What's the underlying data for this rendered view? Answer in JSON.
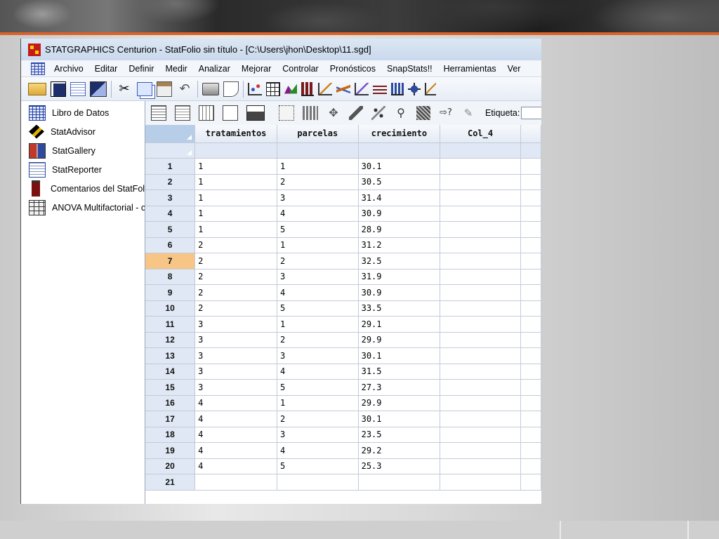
{
  "window": {
    "title": "STATGRAPHICS Centurion - StatFolio sin título - [C:\\Users\\jhon\\Desktop\\11.sgd]"
  },
  "menu": [
    "Archivo",
    "Editar",
    "Definir",
    "Medir",
    "Analizar",
    "Mejorar",
    "Controlar",
    "Pronósticos",
    "SnapStats!!",
    "Herramientas",
    "Ver"
  ],
  "toolbar_icons": [
    "open-folder-icon",
    "save-icon",
    "datasheet-icon",
    "save-all-icon",
    "cut-icon",
    "copy-icon",
    "paste-icon",
    "undo-icon",
    "print-icon",
    "print-preview-icon",
    "scatterplot-icon",
    "table-icon",
    "chart-icon",
    "bar-icon",
    "line-chart-icon",
    "regression-icon",
    "scatter-matrix-icon",
    "list-icon",
    "histogram-icon",
    "crosshair-icon",
    "plot-icon"
  ],
  "sidebar": {
    "items": [
      {
        "label": "Libro de Datos",
        "icon": "datasheet-icon"
      },
      {
        "label": "StatAdvisor",
        "icon": "statadvisor-icon"
      },
      {
        "label": "StatGallery",
        "icon": "statgallery-icon"
      },
      {
        "label": "StatReporter",
        "icon": "statreporter-icon"
      },
      {
        "label": "Comentarios del StatFolio",
        "icon": "comments-icon"
      },
      {
        "label": "ANOVA Multifactorial - cr",
        "icon": "anova-icon"
      }
    ]
  },
  "sheet_toolbar": {
    "label": "Etiqueta:",
    "value": ""
  },
  "table": {
    "columns": [
      "tratamientos",
      "parcelas",
      "crecimiento",
      "Col_4"
    ],
    "selected_row": 7,
    "rows": [
      {
        "n": "1",
        "cells": [
          "1",
          "1",
          "30.1",
          ""
        ]
      },
      {
        "n": "2",
        "cells": [
          "1",
          "2",
          "30.5",
          ""
        ]
      },
      {
        "n": "3",
        "cells": [
          "1",
          "3",
          "31.4",
          ""
        ]
      },
      {
        "n": "4",
        "cells": [
          "1",
          "4",
          "30.9",
          ""
        ]
      },
      {
        "n": "5",
        "cells": [
          "1",
          "5",
          "28.9",
          ""
        ]
      },
      {
        "n": "6",
        "cells": [
          "2",
          "1",
          "31.2",
          ""
        ]
      },
      {
        "n": "7",
        "cells": [
          "2",
          "2",
          "32.5",
          ""
        ]
      },
      {
        "n": "8",
        "cells": [
          "2",
          "3",
          "31.9",
          ""
        ]
      },
      {
        "n": "9",
        "cells": [
          "2",
          "4",
          "30.9",
          ""
        ]
      },
      {
        "n": "10",
        "cells": [
          "2",
          "5",
          "33.5",
          ""
        ]
      },
      {
        "n": "11",
        "cells": [
          "3",
          "1",
          "29.1",
          ""
        ]
      },
      {
        "n": "12",
        "cells": [
          "3",
          "2",
          "29.9",
          ""
        ]
      },
      {
        "n": "13",
        "cells": [
          "3",
          "3",
          "30.1",
          ""
        ]
      },
      {
        "n": "14",
        "cells": [
          "3",
          "4",
          "31.5",
          ""
        ]
      },
      {
        "n": "15",
        "cells": [
          "3",
          "5",
          "27.3",
          ""
        ]
      },
      {
        "n": "16",
        "cells": [
          "4",
          "1",
          "29.9",
          ""
        ]
      },
      {
        "n": "17",
        "cells": [
          "4",
          "2",
          "30.1",
          ""
        ]
      },
      {
        "n": "18",
        "cells": [
          "4",
          "3",
          "23.5",
          ""
        ]
      },
      {
        "n": "19",
        "cells": [
          "4",
          "4",
          "29.2",
          ""
        ]
      },
      {
        "n": "20",
        "cells": [
          "4",
          "5",
          "25.3",
          ""
        ]
      },
      {
        "n": "21",
        "cells": [
          "",
          "",
          "",
          ""
        ]
      }
    ]
  },
  "colors": {
    "accent_line": "#d9632a",
    "selected_row_header": "#f7c586",
    "header_blue": "#dfe8f4"
  }
}
